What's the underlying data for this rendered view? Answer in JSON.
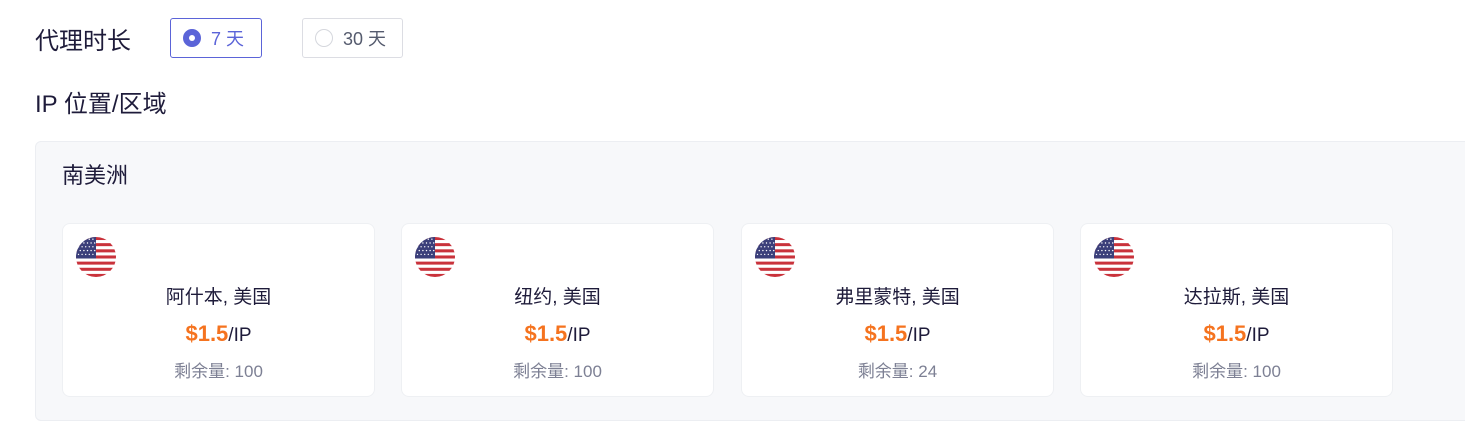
{
  "duration": {
    "label": "代理时长",
    "options": [
      {
        "label": "7 天",
        "selected": true
      },
      {
        "label": "30 天",
        "selected": false
      }
    ]
  },
  "location": {
    "title": "IP 位置/区域"
  },
  "region": {
    "title": "南美洲",
    "cards": [
      {
        "flag_icon": "us-flag-icon",
        "city": "阿什本, 美国",
        "price": "$1.5",
        "unit": "/IP",
        "stock": "剩余量: 100"
      },
      {
        "flag_icon": "us-flag-icon",
        "city": "纽约, 美国",
        "price": "$1.5",
        "unit": "/IP",
        "stock": "剩余量: 100"
      },
      {
        "flag_icon": "us-flag-icon",
        "city": "弗里蒙特, 美国",
        "price": "$1.5",
        "unit": "/IP",
        "stock": "剩余量: 24"
      },
      {
        "flag_icon": "us-flag-icon",
        "city": "达拉斯, 美国",
        "price": "$1.5",
        "unit": "/IP",
        "stock": "剩余量: 100"
      }
    ]
  },
  "colors": {
    "accent": "#5b64d8",
    "price": "#f5731f",
    "panel_bg": "#f7f8fa"
  }
}
